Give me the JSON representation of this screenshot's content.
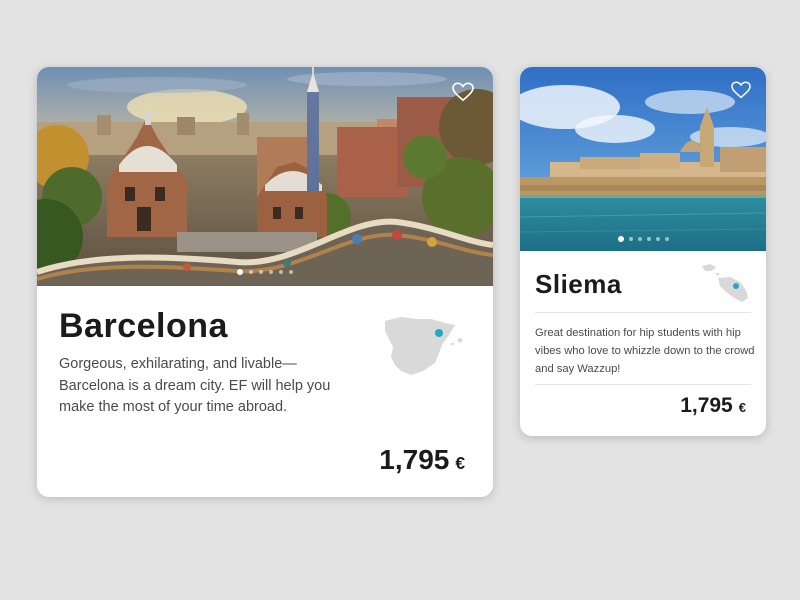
{
  "colors": {
    "background": "#e3e3e3",
    "card": "#ffffff",
    "text_dark": "#1b1b1b",
    "text_body": "#4a4a4a",
    "map_land": "#d9d9d9",
    "map_marker": "#1ea9c8"
  },
  "cards": [
    {
      "city": "Barcelona",
      "description": "Gorgeous, exhilarating, and livable—Barcelona is a dream city. EF will help you make the most of your time abroad.",
      "price": "1,795",
      "currency": "€",
      "photo_count": 6,
      "active_photo": 1,
      "icons": {
        "favorite": "heart-outline-icon",
        "map": "spain-map-icon"
      }
    },
    {
      "city": "Sliema",
      "description": "Great destination for hip students with hip vibes who love to whizzle down to the crowd and say Wazzup!",
      "price": "1,795",
      "currency": "€",
      "photo_count": 6,
      "active_photo": 1,
      "icons": {
        "favorite": "heart-outline-icon",
        "map": "malta-map-icon"
      }
    }
  ]
}
